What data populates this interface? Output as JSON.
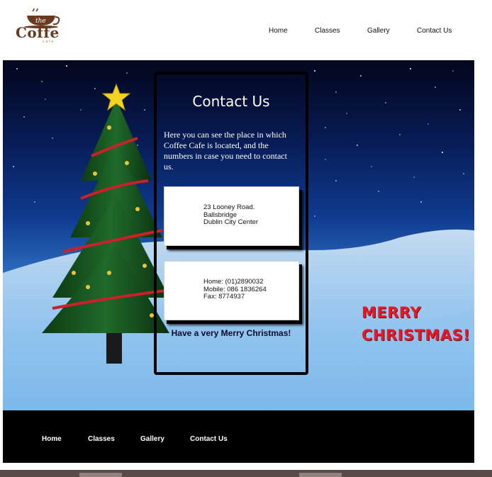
{
  "logo": {
    "the": "the",
    "name": "Coffe",
    "sub": "cafe"
  },
  "nav": {
    "items": [
      "Home",
      "Classes",
      "Gallery",
      "Contact Us"
    ]
  },
  "panel": {
    "title": "Contact Us",
    "intro": "Here you can see the place in which Coffee Cafe is located, and the numbers in case you need to contact us.",
    "address": [
      "23 Looney Road.",
      "Ballsbridge",
      "Dublin City Center"
    ],
    "phones": [
      "Home: (01)2890032",
      "Mobile: 086 1836264",
      "Fax: 8774937"
    ],
    "greeting": "Have a very Merry Christmas!"
  },
  "merry": {
    "line1": "MERRY",
    "line2": "CHRISTMAS!"
  },
  "footer": {
    "items": [
      "Home",
      "Classes",
      "Gallery",
      "Contact Us"
    ]
  },
  "colors": {
    "accent": "#e21a2a",
    "brand": "#6b3a1e",
    "footer": "#000000"
  }
}
